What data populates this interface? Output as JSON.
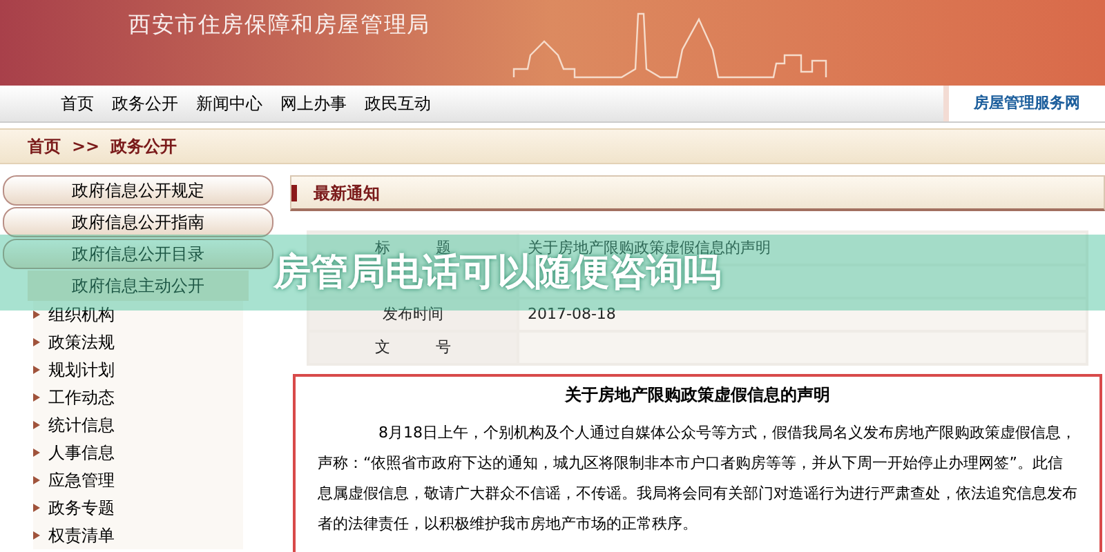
{
  "header": {
    "subtitle": "西安市住房保障和房屋管理局"
  },
  "nav": {
    "items": [
      {
        "label": "首页"
      },
      {
        "label": "政务公开"
      },
      {
        "label": "新闻中心"
      },
      {
        "label": "网上办事"
      },
      {
        "label": "政民互动"
      }
    ],
    "side_link": "房屋管理服务网"
  },
  "breadcrumb": {
    "items": [
      "首页",
      "政务公开"
    ],
    "separator": ">>"
  },
  "sidebar": {
    "items": [
      {
        "kind": "scroll",
        "label": "政府信息公开规定"
      },
      {
        "kind": "scroll",
        "label": "政府信息公开指南"
      },
      {
        "kind": "scroll",
        "label": "政府信息公开目录"
      },
      {
        "kind": "heading",
        "label": "政府信息主动公开"
      },
      {
        "kind": "link",
        "label": "组织机构"
      },
      {
        "kind": "link",
        "label": "政策法规"
      },
      {
        "kind": "link",
        "label": "规划计划"
      },
      {
        "kind": "link",
        "label": "工作动态"
      },
      {
        "kind": "link",
        "label": "统计信息"
      },
      {
        "kind": "link",
        "label": "人事信息"
      },
      {
        "kind": "link",
        "label": "应急管理"
      },
      {
        "kind": "link",
        "label": "政务专题"
      },
      {
        "kind": "link",
        "label": "权责清单"
      }
    ]
  },
  "content": {
    "title": "最新通知",
    "meta": [
      {
        "label": "标　　　题",
        "value": "关于房地产限购政策虚假信息的声明"
      },
      {
        "label": "发布时间",
        "value": "2017-08-18"
      },
      {
        "label": "文　　　号"
      }
    ],
    "article": {
      "title": "关于房地产限购政策虚假信息的声明",
      "body": "8月18日上午，个别机构及个人通过自媒体公众号等方式，假借我局名义发布房地产限购政策虚假信息，声称：“依照省市政府下达的通知，城九区将限制非本市户口者购房等等，并从下周一开始停止办理网签”。此信息属虚假信息，敬请广大群众不信谣，不传谣。我局将会同有关部门对造谣行为进行严肃查处，依法追究信息发布者的法律责任，以积极维护我市房地产市场的正常秩序。"
    }
  },
  "overlay": {
    "title": "房管局电话可以随便咨询吗"
  }
}
